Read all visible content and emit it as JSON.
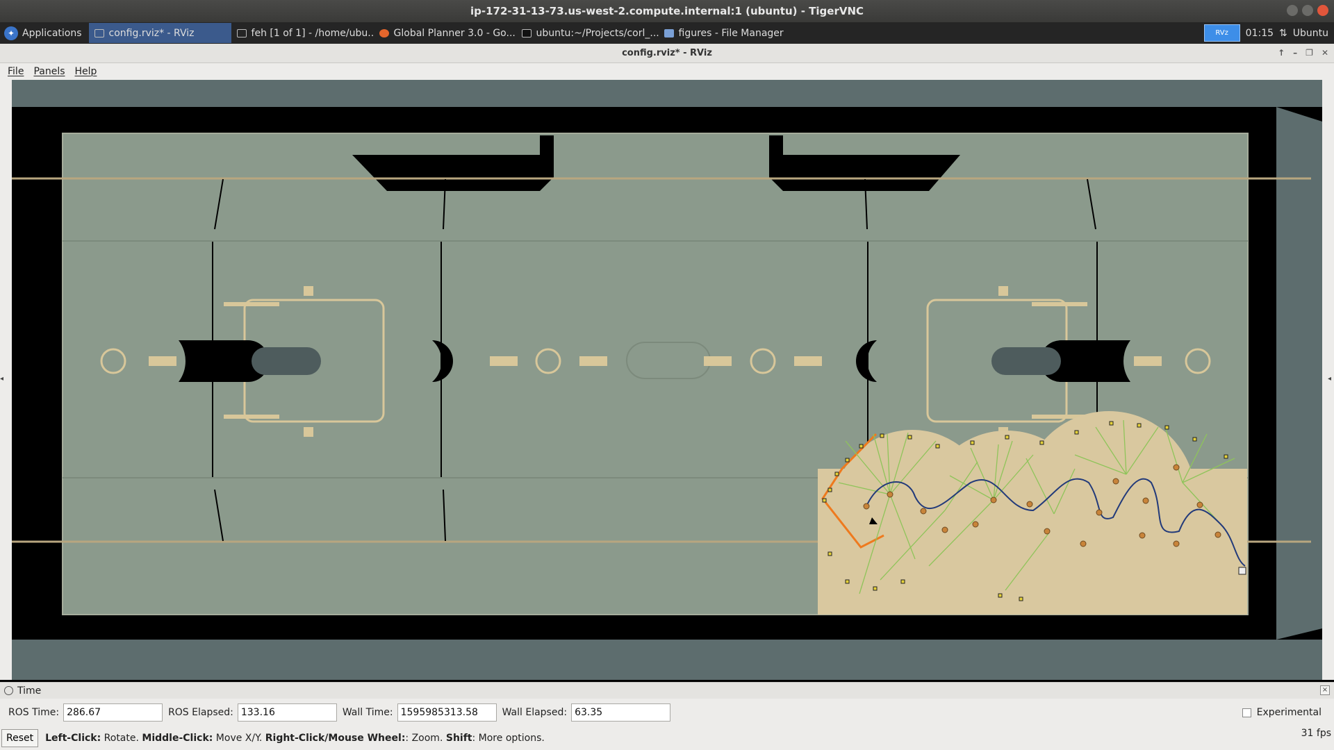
{
  "vnc": {
    "title": "ip-172-31-13-73.us-west-2.compute.internal:1 (ubuntu) - TigerVNC"
  },
  "panel": {
    "applications": "Applications",
    "tasks": [
      {
        "label": "config.rviz* - RViz",
        "icon": "rviz-icon",
        "active": true
      },
      {
        "label": "feh [1 of 1] - /home/ubu...",
        "icon": "window-icon",
        "active": false
      },
      {
        "label": "Global Planner 3.0 - Go...",
        "icon": "firefox-icon",
        "active": false
      },
      {
        "label": "ubuntu:~/Projects/corl_...",
        "icon": "terminal-icon",
        "active": false
      },
      {
        "label": "figures - File Manager",
        "icon": "folder-icon",
        "active": false
      }
    ],
    "keyboard_badge": "RVz",
    "clock": "01:15",
    "user": "Ubuntu"
  },
  "rviz": {
    "title": "config.rviz* - RViz",
    "menu": {
      "file": "File",
      "panels": "Panels",
      "help": "Help"
    }
  },
  "time_panel": {
    "title": "Time",
    "ros_time_label": "ROS Time:",
    "ros_time": "286.67",
    "ros_elapsed_label": "ROS Elapsed:",
    "ros_elapsed": "133.16",
    "wall_time_label": "Wall Time:",
    "wall_time": "1595985313.58",
    "wall_elapsed_label": "Wall Elapsed:",
    "wall_elapsed": "63.35",
    "experimental": "Experimental"
  },
  "status": {
    "reset": "Reset",
    "left_click": "Left-Click:",
    "left_click_desc": " Rotate. ",
    "middle_click": "Middle-Click:",
    "middle_click_desc": " Move X/Y. ",
    "right_click": "Right-Click/Mouse Wheel:",
    "right_click_desc": ": Zoom. ",
    "shift": "Shift",
    "shift_desc": ": More options.",
    "fps": "31 fps"
  },
  "colors": {
    "floor": "#8b9a8c",
    "walls": "#000000",
    "costmap": "#d9c89f",
    "path_orange": "#ee7a1e",
    "tree_green": "#8fc45a",
    "plan_blue": "#223a7a",
    "active_tab": "#3b5a8c"
  }
}
